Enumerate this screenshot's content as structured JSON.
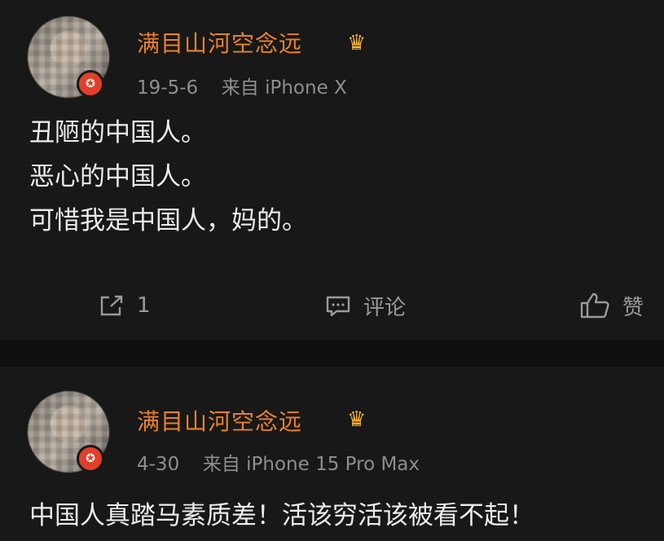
{
  "posts": [
    {
      "username": "满目山河空念远",
      "date": "19-5-6",
      "source": "来自 iPhone X",
      "lines": [
        "丑陋的中国人。",
        "恶心的中国人。",
        "可惜我是中国人，妈的。"
      ],
      "actions": {
        "repost_count": "1",
        "comment_label": "评论",
        "like_label": "赞"
      }
    },
    {
      "username": "满目山河空念远",
      "date": "4-30",
      "source": "来自 iPhone 15 Pro Max",
      "lines": [
        "中国人真踏马素质差！活该穷活该被看不起！"
      ]
    }
  ],
  "colors": {
    "username": "#e6822e",
    "badge": "#e0402a",
    "crown": "#f5b33b"
  }
}
